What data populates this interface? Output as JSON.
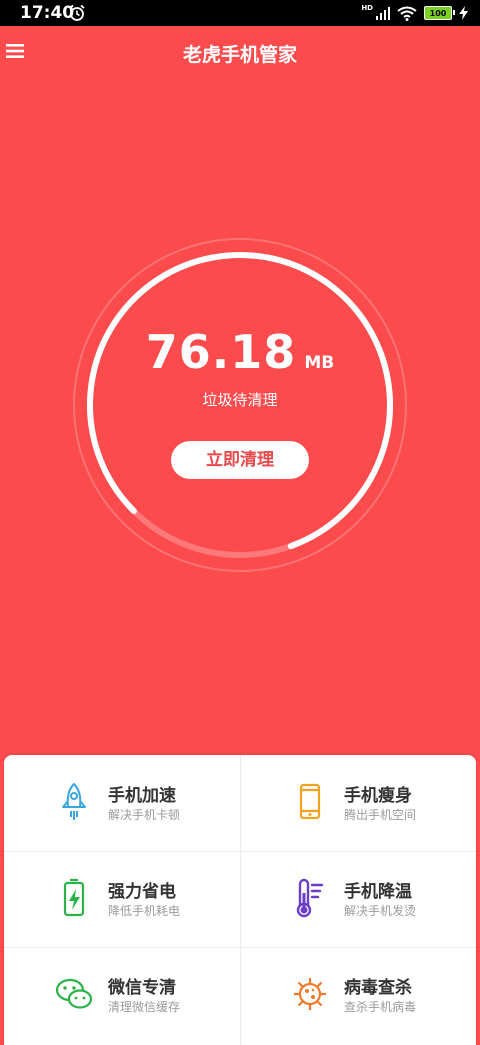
{
  "status_bar": {
    "time": "17:40",
    "network_label": "HD",
    "battery_level": "100"
  },
  "header": {
    "title": "老虎手机管家"
  },
  "gauge": {
    "value": "76.18",
    "unit": "MB",
    "subtitle": "垃圾待清理",
    "button_label": "立即清理",
    "progress": 0.82
  },
  "features": [
    {
      "title": "手机加速",
      "desc": "解决手机卡顿",
      "icon": "rocket-icon",
      "color": "#3aa6e0"
    },
    {
      "title": "手机瘦身",
      "desc": "腾出手机空间",
      "icon": "phone-icon",
      "color": "#f2a21e"
    },
    {
      "title": "强力省电",
      "desc": "降低手机耗电",
      "icon": "battery-icon",
      "color": "#2bb34a"
    },
    {
      "title": "手机降温",
      "desc": "解决手机发烫",
      "icon": "thermometer-icon",
      "color": "#6a3ec9"
    },
    {
      "title": "微信专清",
      "desc": "清理微信缓存",
      "icon": "wechat-icon",
      "color": "#2bb34a"
    },
    {
      "title": "病毒查杀",
      "desc": "查杀手机病毒",
      "icon": "virus-icon",
      "color": "#f07a2a"
    }
  ],
  "colors": {
    "background": "#fb4b4d",
    "button_text": "#e8494b"
  }
}
